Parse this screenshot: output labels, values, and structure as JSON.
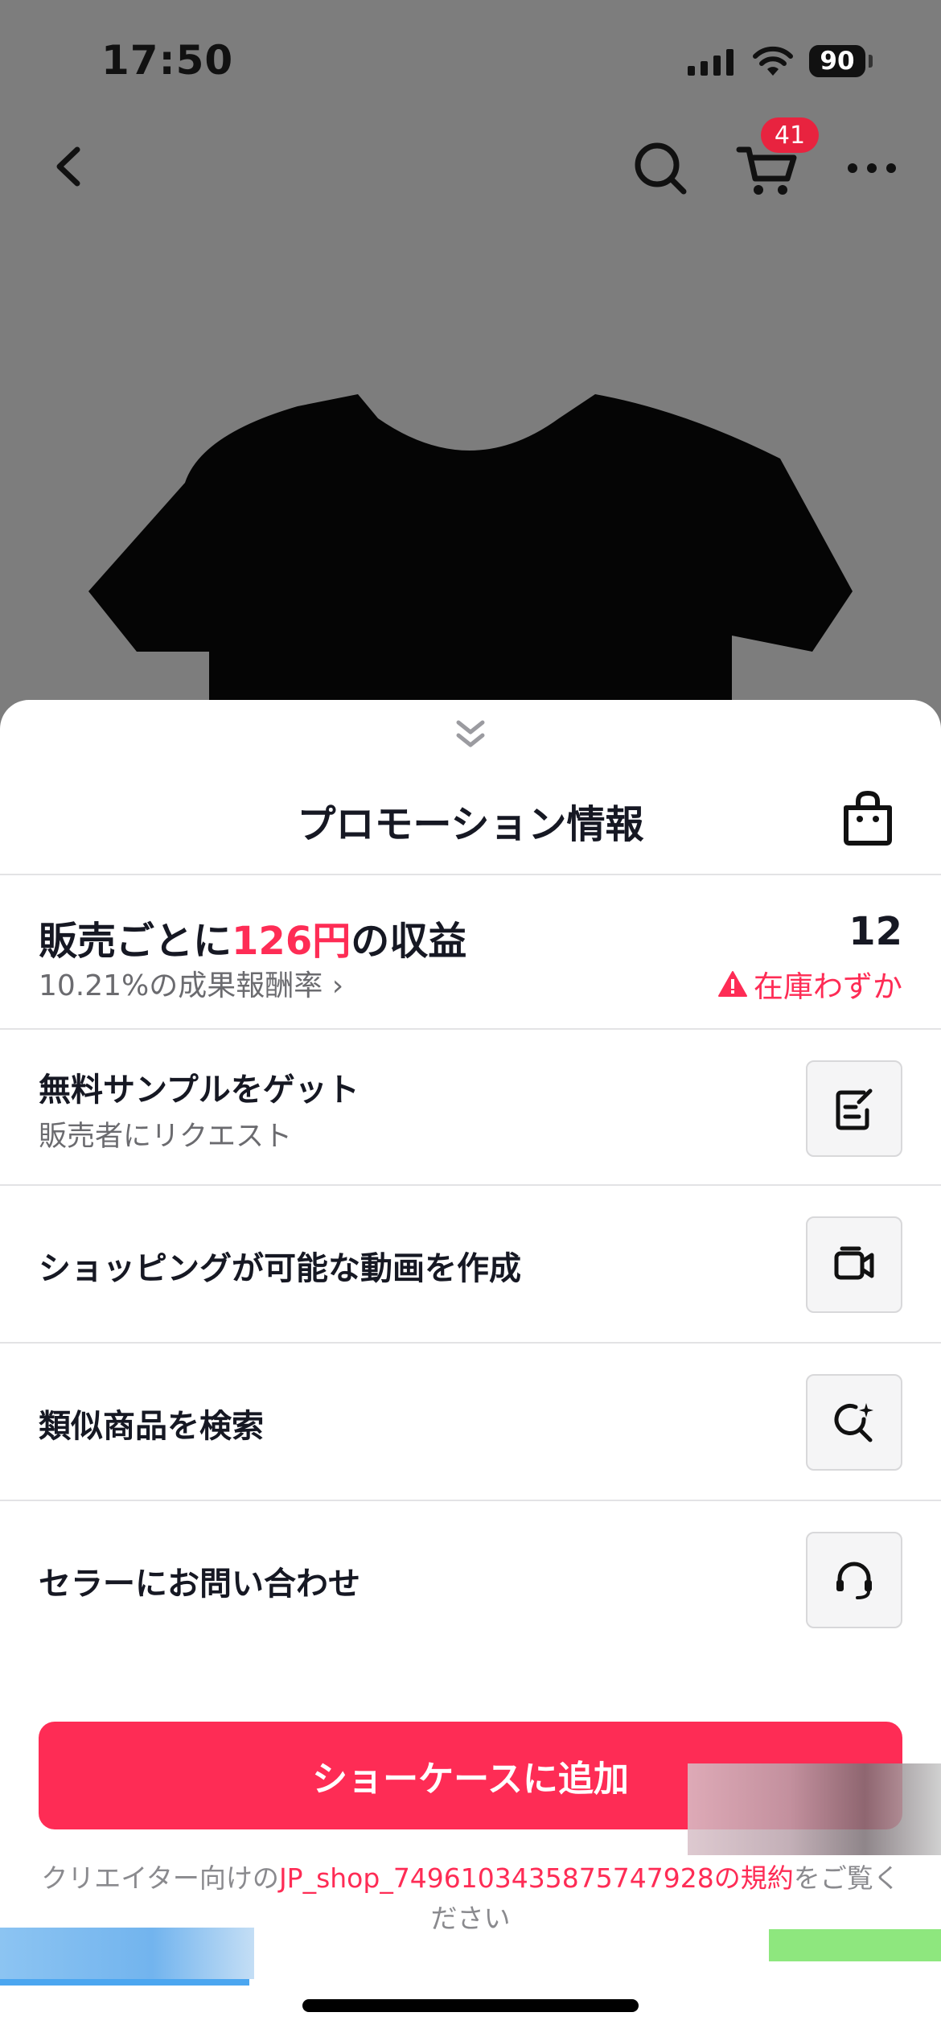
{
  "status_bar": {
    "time": "17:50",
    "battery": "90"
  },
  "nav": {
    "cart_badge": "41"
  },
  "sheet": {
    "title": "プロモーション情報",
    "earnings": {
      "prefix": "販売ごとに",
      "amount": "126円",
      "suffix": "の収益",
      "rate": "10.21%の成果報酬率 ›",
      "count": "12",
      "stock_warning": "在庫わずか"
    },
    "actions": [
      {
        "label": "無料サンプルをゲット",
        "sublabel": "販売者にリクエスト",
        "icon": "document-edit-icon"
      },
      {
        "label": "ショッピングが可能な動画を作成",
        "icon": "video-camera-icon"
      },
      {
        "label": "類似商品を検索",
        "icon": "sparkle-search-icon"
      },
      {
        "label": "セラーにお問い合わせ",
        "icon": "headset-icon"
      }
    ],
    "cta_label": "ショーケースに追加",
    "terms": {
      "before": "クリエイター向けの",
      "link": "JP_shop_7496103435875747928の規約",
      "after": "をご覧ください"
    }
  },
  "colors": {
    "accent": "#fe2c55",
    "overlay": "#7d7d7d"
  }
}
